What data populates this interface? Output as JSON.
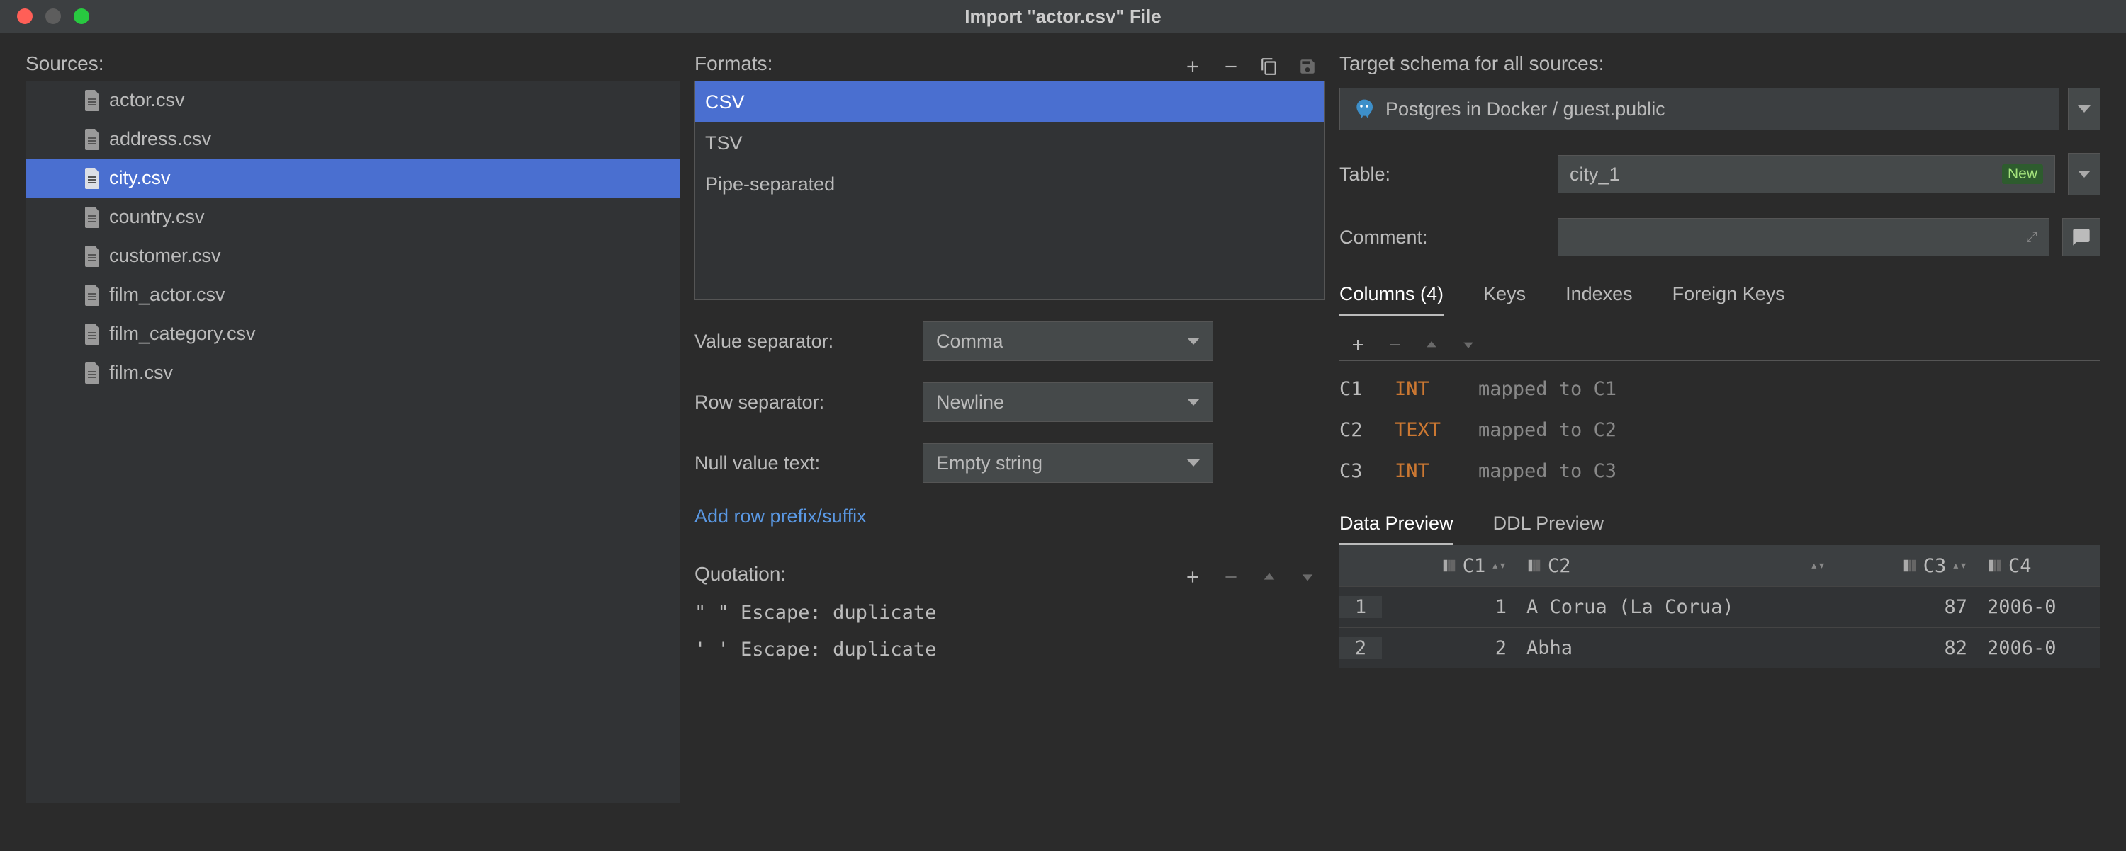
{
  "window": {
    "title": "Import \"actor.csv\" File"
  },
  "left": {
    "label": "Sources:",
    "files": [
      {
        "name": "actor.csv",
        "selected": false
      },
      {
        "name": "address.csv",
        "selected": false
      },
      {
        "name": "city.csv",
        "selected": true
      },
      {
        "name": "country.csv",
        "selected": false
      },
      {
        "name": "customer.csv",
        "selected": false
      },
      {
        "name": "film_actor.csv",
        "selected": false
      },
      {
        "name": "film_category.csv",
        "selected": false
      },
      {
        "name": "film.csv",
        "selected": false
      }
    ]
  },
  "mid": {
    "formats_label": "Formats:",
    "formats": [
      {
        "name": "CSV",
        "selected": true
      },
      {
        "name": "TSV",
        "selected": false
      },
      {
        "name": "Pipe-separated",
        "selected": false
      }
    ],
    "value_sep_label": "Value separator:",
    "value_sep": "Comma",
    "row_sep_label": "Row separator:",
    "row_sep": "Newline",
    "null_text_label": "Null value text:",
    "null_text": "Empty string",
    "add_prefix_link": "Add row prefix/suffix",
    "quotation_label": "Quotation:",
    "quotations": [
      {
        "chars": "\" \"",
        "escape_label": "Escape:",
        "escape": "duplicate"
      },
      {
        "chars": "' '",
        "escape_label": "Escape:",
        "escape": "duplicate"
      }
    ]
  },
  "right": {
    "target_label": "Target schema for all sources:",
    "target_value": "Postgres in Docker / guest.public",
    "table_label": "Table:",
    "table_value": "city_1",
    "table_new_badge": "New",
    "comment_label": "Comment:",
    "comment_value": "",
    "tabs": {
      "columns": "Columns (4)",
      "keys": "Keys",
      "indexes": "Indexes",
      "fks": "Foreign Keys"
    },
    "mappings": [
      {
        "col": "C1",
        "type": "INT",
        "text": "mapped to C1"
      },
      {
        "col": "C2",
        "type": "TEXT",
        "text": "mapped to C2"
      },
      {
        "col": "C3",
        "type": "INT",
        "text": "mapped to C3"
      }
    ],
    "preview_tabs": {
      "data": "Data Preview",
      "ddl": "DDL Preview"
    },
    "preview_columns": [
      "C1",
      "C2",
      "C3",
      "C4"
    ],
    "preview_rows": [
      {
        "n": "1",
        "c1": "1",
        "c2": "A Corua (La Corua)",
        "c3": "87",
        "c4": "2006-0"
      },
      {
        "n": "2",
        "c1": "2",
        "c2": "Abha",
        "c3": "82",
        "c4": "2006-0"
      }
    ]
  }
}
